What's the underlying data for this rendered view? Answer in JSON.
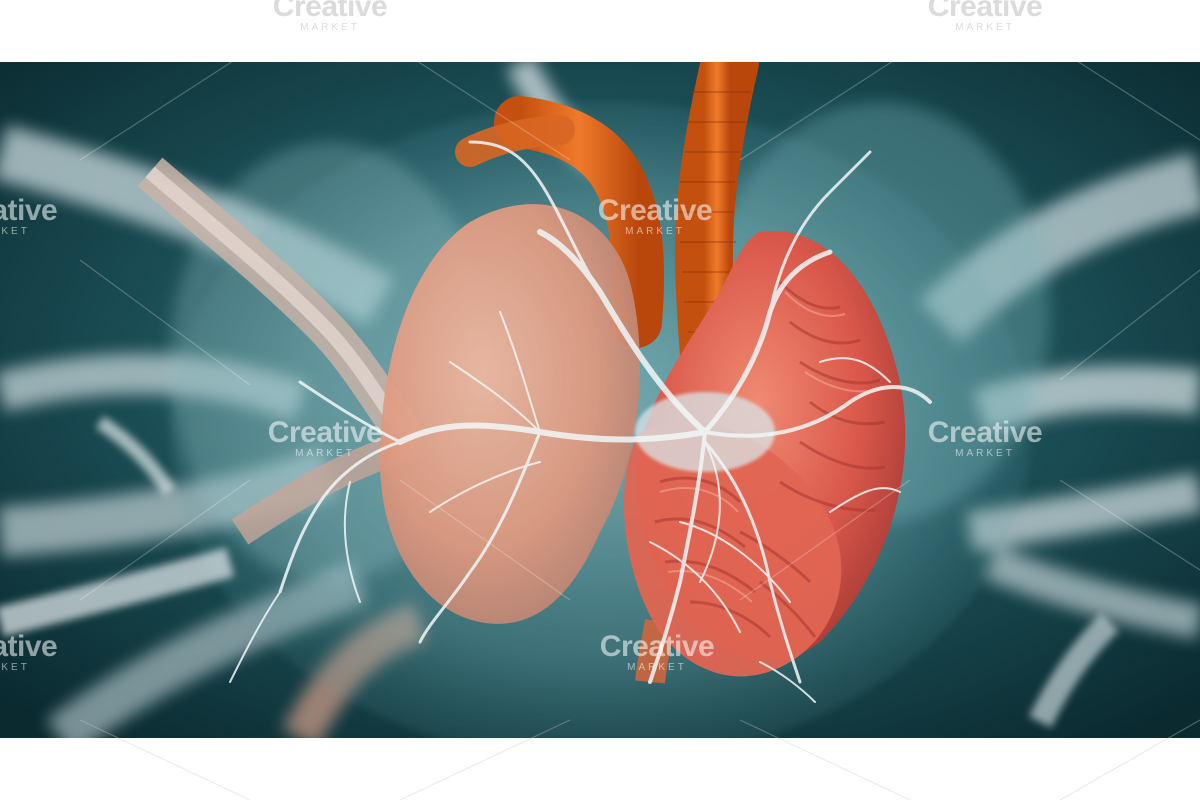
{
  "image": {
    "subject": "3D rendering of a human heart with vessels and nerve network",
    "colors": {
      "background_teal": "#0f3b43",
      "heart_red": "#e0604a",
      "aorta_orange": "#e86a20",
      "tissue_white": "#dfe8ea"
    }
  },
  "watermarks": [
    {
      "brand": "Creative",
      "sub": "MARKET"
    },
    {
      "brand": "Creative",
      "sub": "MARKET"
    },
    {
      "brand": "Creative",
      "sub": "MARKET"
    },
    {
      "brand": "Creative",
      "sub": "MARKET"
    },
    {
      "brand": "Creative",
      "sub": "MARKET"
    },
    {
      "brand": "Creative",
      "sub": "MARKET"
    },
    {
      "brand": "Creative",
      "sub": "MARKET"
    },
    {
      "brand": "Creative",
      "sub": "MARKET"
    }
  ]
}
